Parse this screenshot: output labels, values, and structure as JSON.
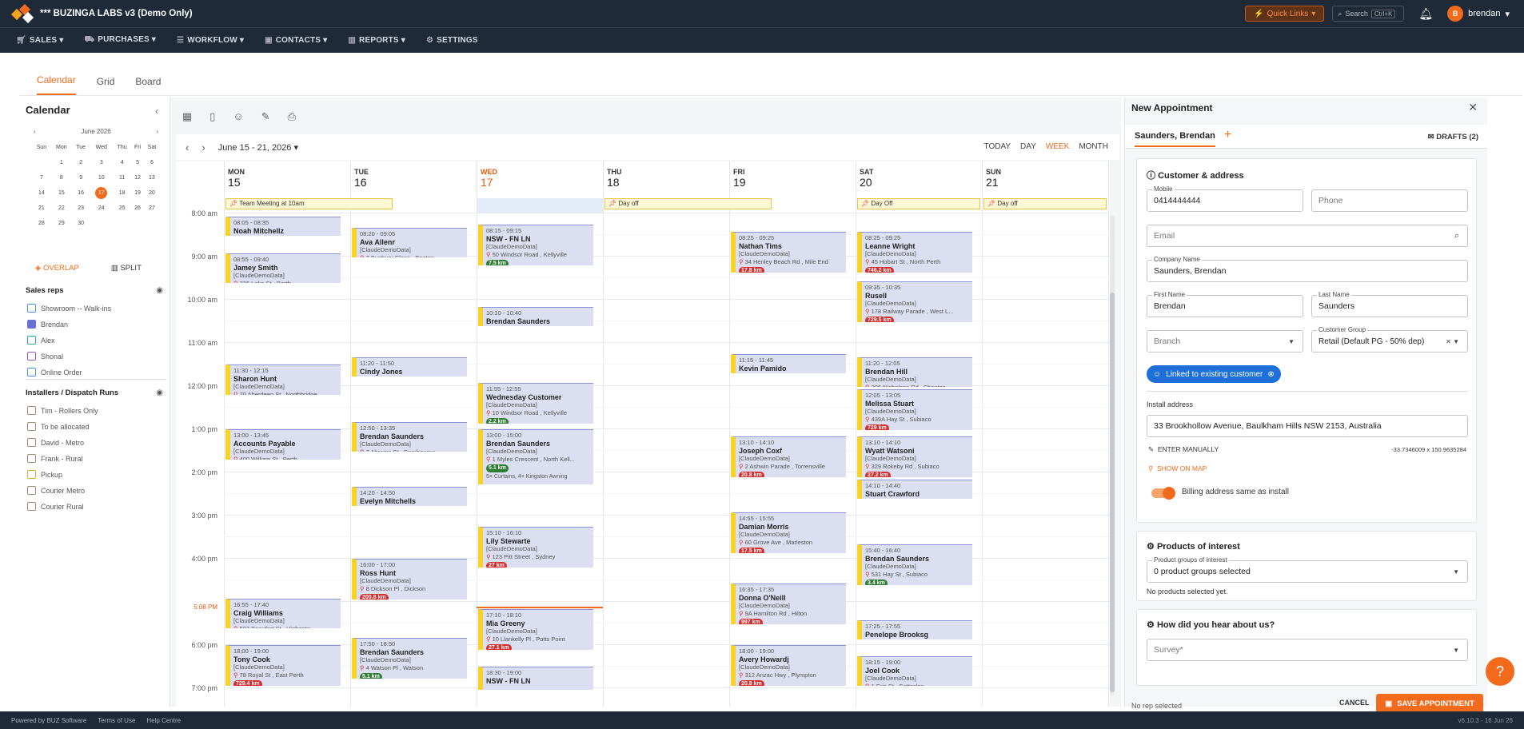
{
  "app": {
    "title": "*** BUZINGA LABS v3 (Demo Only)",
    "quick_links": "Quick Links",
    "search": "Search",
    "search_kbd": "Ctrl+K",
    "user": "brendan",
    "user_initial": "B"
  },
  "nav": [
    "SALES",
    "PURCHASES",
    "WORKFLOW",
    "CONTACTS",
    "REPORTS",
    "SETTINGS"
  ],
  "tabs": [
    "Calendar",
    "Grid",
    "Board"
  ],
  "left": {
    "title": "Calendar",
    "month": "June 2026",
    "weekdays": [
      "Sun",
      "Mon",
      "Tue",
      "Wed",
      "Thu",
      "Fri",
      "Sat"
    ],
    "weeks": [
      [
        "",
        "1",
        "2",
        "3",
        "4",
        "5",
        "6"
      ],
      [
        "7",
        "8",
        "9",
        "10",
        "11",
        "12",
        "13"
      ],
      [
        "14",
        "15",
        "16",
        "17",
        "18",
        "19",
        "20"
      ],
      [
        "21",
        "22",
        "23",
        "24",
        "25",
        "26",
        "27"
      ],
      [
        "28",
        "29",
        "30",
        "",
        "",
        "",
        ""
      ]
    ],
    "selected_day": "17",
    "overlay": "OVERLAP",
    "split": "SPLIT",
    "sales_reps_title": "Sales reps",
    "sales_reps": [
      {
        "label": "Showroom -- Walk-ins",
        "color": "#4a90d9"
      },
      {
        "label": "Brendan",
        "color": "#6b6fd1"
      },
      {
        "label": "Alex",
        "color": "#26a69a"
      },
      {
        "label": "Shonal",
        "color": "#9c5ab8"
      },
      {
        "label": "Online Order",
        "color": "#4a90d9"
      }
    ],
    "installers_title": "Installers / Dispatch Runs",
    "installers": [
      {
        "label": "Tim - Rollers Only",
        "color": "#a1887f"
      },
      {
        "label": "To be allocated",
        "color": "#a1887f"
      },
      {
        "label": "David - Metro",
        "color": "#a1887f"
      },
      {
        "label": "Frank - Rural",
        "color": "#a1887f"
      },
      {
        "label": "Pickup",
        "color": "#d4b03a"
      },
      {
        "label": "Courier Metro",
        "color": "#a1887f"
      },
      {
        "label": "Courier Rural",
        "color": "#a1887f"
      }
    ]
  },
  "cal": {
    "range": "June 15 - 21, 2026",
    "views": [
      "TODAY",
      "DAY",
      "WEEK",
      "MONTH"
    ],
    "active_view": "WEEK",
    "days": [
      {
        "d": "MON",
        "n": "15"
      },
      {
        "d": "TUE",
        "n": "16"
      },
      {
        "d": "WED",
        "n": "17"
      },
      {
        "d": "THU",
        "n": "18"
      },
      {
        "d": "FRI",
        "n": "19"
      },
      {
        "d": "SAT",
        "n": "20"
      },
      {
        "d": "SUN",
        "n": "21"
      }
    ],
    "today_index": 2,
    "hours": [
      "8:00 am",
      "9:00 am",
      "10:00 am",
      "11:00 am",
      "12:00 pm",
      "1:00 pm",
      "2:00 pm",
      "3:00 pm",
      "4:00 pm",
      "5:08 PM",
      "6:00 pm",
      "7:00 pm"
    ],
    "allday": [
      {
        "day": 0,
        "span": 1.35,
        "label": "Team Meeting at 10am"
      },
      {
        "day": 3,
        "span": 1.35,
        "label": "Day off"
      },
      {
        "day": 5,
        "span": 1,
        "label": "Day Off"
      },
      {
        "day": 6,
        "span": 1,
        "label": "Day off"
      }
    ],
    "events": [
      {
        "day": 0,
        "start": 8.08,
        "end": 8.58,
        "time": "08:05 - 08:35",
        "name": "Noah Mitchellz",
        "org": "",
        "addr": "",
        "badge": ""
      },
      {
        "day": 0,
        "start": 8.92,
        "end": 9.67,
        "time": "08:55 - 09:40",
        "name": "Jamey Smith",
        "org": "[ClaudeDemoData]",
        "addr": "226 Lake St , Perth",
        "badge": ""
      },
      {
        "day": 0,
        "start": 11.5,
        "end": 12.25,
        "time": "11:30 - 12:15",
        "name": "Sharon Hunt",
        "org": "[ClaudeDemoData]",
        "addr": "70 Aberdeen St , Northbridge",
        "badge": ""
      },
      {
        "day": 0,
        "start": 13.0,
        "end": 13.75,
        "time": "13:00 - 13:45",
        "name": "Accounts Payable",
        "org": "[ClaudeDemoData]",
        "addr": "400 William St , Perth",
        "badge": ""
      },
      {
        "day": 0,
        "start": 16.92,
        "end": 17.67,
        "time": "16:55 - 17:40",
        "name": "Craig Williams",
        "org": "[ClaudeDemoData]",
        "addr": "507 Beaufort St , Highgate",
        "badge": ""
      },
      {
        "day": 0,
        "start": 18.0,
        "end": 19.0,
        "time": "18:00 - 19:00",
        "name": "Tony Cook",
        "org": "[ClaudeDemoData]",
        "addr": "78 Royal St , East Perth",
        "badge": "729.4 km",
        "g": false
      },
      {
        "day": 1,
        "start": 8.33,
        "end": 9.08,
        "time": "08:20 - 09:05",
        "name": "Ava Allenr",
        "org": "[ClaudeDemoData]",
        "addr": "7 Bunbury Close , Beeton",
        "badge": ""
      },
      {
        "day": 1,
        "start": 11.33,
        "end": 11.83,
        "time": "11:20 - 11:50",
        "name": "Cindy Jones",
        "org": "",
        "addr": "",
        "badge": ""
      },
      {
        "day": 1,
        "start": 12.83,
        "end": 13.58,
        "time": "12:50 - 13:35",
        "name": "Brendan Saunders",
        "org": "[ClaudeDemoData]",
        "addr": "7 Abrams St , Cranbourne",
        "badge": ""
      },
      {
        "day": 1,
        "start": 14.33,
        "end": 14.83,
        "time": "14:20 - 14:50",
        "name": "Evelyn Mitchells",
        "org": "",
        "addr": "",
        "badge": ""
      },
      {
        "day": 1,
        "start": 16.0,
        "end": 17.0,
        "time": "16:00 - 17:00",
        "name": "Ross Hunt",
        "org": "[ClaudeDemoData]",
        "addr": "8 Dickson Pl , Dickson",
        "badge": "200.8 km",
        "g": false
      },
      {
        "day": 1,
        "start": 17.83,
        "end": 18.83,
        "time": "17:50 - 18:50",
        "name": "Brendan Saunders",
        "org": "[ClaudeDemoData]",
        "addr": "4 Watson Pl , Watson",
        "badge": "5.1 km",
        "g": true
      },
      {
        "day": 2,
        "start": 8.25,
        "end": 9.25,
        "time": "08:15 - 09:15",
        "name": "NSW - FN LN",
        "org": "[ClaudeDemoData]",
        "addr": "50 Windsor Road , Kellyville",
        "badge": "7.5 km",
        "g": true
      },
      {
        "day": 2,
        "start": 10.17,
        "end": 10.67,
        "time": "10:10 - 10:40",
        "name": "Brendan Saunders",
        "org": "",
        "addr": "",
        "badge": ""
      },
      {
        "day": 2,
        "start": 11.92,
        "end": 12.92,
        "time": "11:55 - 12:55",
        "name": "Wednesday Customer",
        "org": "[ClaudeDemoData]",
        "addr": "10 Windsor Road , Kellyville",
        "badge": "2.2 km",
        "g": true
      },
      {
        "day": 2,
        "start": 13.0,
        "end": 14.33,
        "time": "13:00 - 15:00",
        "name": "Brendan Saunders",
        "org": "[ClaudeDemoData]",
        "addr": "1 Myles Crescent , North Kell...",
        "badge": "5.1 km",
        "g": true,
        "extra": "5× Curtains, 4× Kingston Awning"
      },
      {
        "day": 2,
        "start": 15.25,
        "end": 16.25,
        "time": "15:10 - 16:10",
        "name": "Lily Stewarte",
        "org": "[ClaudeDemoData]",
        "addr": "123 Pitt Street , Sydney",
        "badge": "27 km",
        "g": false
      },
      {
        "day": 2,
        "start": 17.17,
        "end": 18.17,
        "time": "17:10 - 18:10",
        "name": "Mia Greeny",
        "org": "[ClaudeDemoData]",
        "addr": "10 Llankelly Pl , Potts Point",
        "badge": "27.1 km",
        "g": false
      },
      {
        "day": 2,
        "start": 18.5,
        "end": 19.1,
        "time": "18:30 - 19:00",
        "name": "NSW - FN LN",
        "org": "",
        "addr": "",
        "badge": ""
      },
      {
        "day": 4,
        "start": 8.42,
        "end": 9.42,
        "time": "08:25 - 09:25",
        "name": "Nathan Tims",
        "org": "[ClaudeDemoData]",
        "addr": "34 Henley Beach Rd , Mile End",
        "badge": "17.8 km",
        "g": false
      },
      {
        "day": 4,
        "start": 11.25,
        "end": 11.75,
        "time": "11:15 - 11:45",
        "name": "Kevin Pamido",
        "org": "",
        "addr": "",
        "badge": ""
      },
      {
        "day": 4,
        "start": 13.17,
        "end": 14.17,
        "time": "13:10 - 14:10",
        "name": "Joseph Coxf",
        "org": "[ClaudeDemoData]",
        "addr": "2 Ashwin Parade , Torrensville",
        "badge": "20.8 km",
        "g": false
      },
      {
        "day": 4,
        "start": 14.92,
        "end": 15.92,
        "time": "14:55 - 15:55",
        "name": "Damian Morris",
        "org": "[ClaudeDemoData]",
        "addr": "60 Grove Ave , Marleston",
        "badge": "17.5 km",
        "g": false
      },
      {
        "day": 4,
        "start": 16.58,
        "end": 17.58,
        "time": "16:35 - 17:35",
        "name": "Donna O'Neill",
        "org": "[ClaudeDemoData]",
        "addr": "9A Hamilton Rd , Hilton",
        "badge": "997 km",
        "g": false
      },
      {
        "day": 4,
        "start": 18.0,
        "end": 19.0,
        "time": "18:00 - 19:00",
        "name": "Avery Howardj",
        "org": "[ClaudeDemoData]",
        "addr": "312 Anzac Hwy , Plympton",
        "badge": "20.8 km",
        "g": false
      },
      {
        "day": 5,
        "start": 8.42,
        "end": 9.42,
        "time": "08:25 - 09:25",
        "name": "Leanne Wright",
        "org": "[ClaudeDemoData]",
        "addr": "45 Hobart St , North Perth",
        "badge": "746.2 km",
        "g": false
      },
      {
        "day": 5,
        "start": 9.58,
        "end": 10.58,
        "time": "09:35 - 10:35",
        "name": "Rusell",
        "org": "[ClaudeDemoData]",
        "addr": "178 Railway Parade , West L...",
        "badge": "729.5 km",
        "g": false
      },
      {
        "day": 5,
        "start": 11.33,
        "end": 12.08,
        "time": "11:20 - 12:05",
        "name": "Brendan Hill",
        "org": "[ClaudeDemoData]",
        "addr": "206 Nicholson Rd , Shenton",
        "badge": ""
      },
      {
        "day": 5,
        "start": 12.08,
        "end": 13.08,
        "time": "12:05 - 13:05",
        "name": "Melissa Stuart",
        "org": "[ClaudeDemoData]",
        "addr": "439A Hay St , Subiaco",
        "badge": "729 km",
        "g": false
      },
      {
        "day": 5,
        "start": 13.17,
        "end": 14.17,
        "time": "13:10 - 14:10",
        "name": "Wyatt Watsoni",
        "org": "[ClaudeDemoData]",
        "addr": "329 Rokeby Rd , Subiaco",
        "badge": "27.2 km",
        "g": false
      },
      {
        "day": 5,
        "start": 14.17,
        "end": 14.67,
        "time": "14:10 - 14:40",
        "name": "Stuart Crawford",
        "org": "",
        "addr": "",
        "badge": ""
      },
      {
        "day": 5,
        "start": 15.67,
        "end": 16.67,
        "time": "15:40 - 16:40",
        "name": "Brendan Saunders",
        "org": "[ClaudeDemoData]",
        "addr": "531 Hay St , Subiaco",
        "badge": "3.4 km",
        "g": true
      },
      {
        "day": 5,
        "start": 17.42,
        "end": 17.92,
        "time": "17:25 - 17:55",
        "name": "Penelope Brooksg",
        "org": "",
        "addr": "",
        "badge": ""
      },
      {
        "day": 5,
        "start": 18.25,
        "end": 19.0,
        "time": "18:15 - 19:00",
        "name": "Joel Cook",
        "org": "[ClaudeDemoData]",
        "addr": "1 Eric St , Cottesloe",
        "badge": ""
      }
    ]
  },
  "right": {
    "title": "New Appointment",
    "tab": "Saunders, Brendan",
    "drafts": "DRAFTS (2)",
    "section1": "Customer & address",
    "mobile_label": "Mobile",
    "mobile": "0414444444",
    "phone_ph": "Phone",
    "email_ph": "Email",
    "company_label": "Company Name",
    "company": "Saunders, Brendan",
    "first_label": "First Name",
    "first": "Brendan",
    "last_label": "Last Name",
    "last": "Saunders",
    "branch_ph": "Branch",
    "group_label": "Customer Group",
    "group": "Retail (Default PG - 50% dep)",
    "linked": "Linked to existing customer",
    "install_label": "Install address",
    "install": "33 Brookhollow Avenue, Baulkham Hills NSW 2153, Australia",
    "enter_manually": "ENTER MANUALLY",
    "coords": "-33.7346009 x 150.9635284",
    "show_map": "SHOW ON MAP",
    "billing": "Billing address same as install",
    "section2": "Products of interest",
    "pg_label": "Product groups of interest",
    "pg": "0 product groups selected",
    "no_products": "No products selected yet.",
    "section3": "How did you hear about us?",
    "survey_ph": "Survey*",
    "no_rep": "No rep selected",
    "cancel": "CANCEL",
    "save": "SAVE APPOINTMENT"
  },
  "footer": {
    "powered": "Powered by BUZ Software",
    "terms": "Terms of Use",
    "help": "Help Centre",
    "version": "v6.10.3 - 16 Jun 26"
  }
}
